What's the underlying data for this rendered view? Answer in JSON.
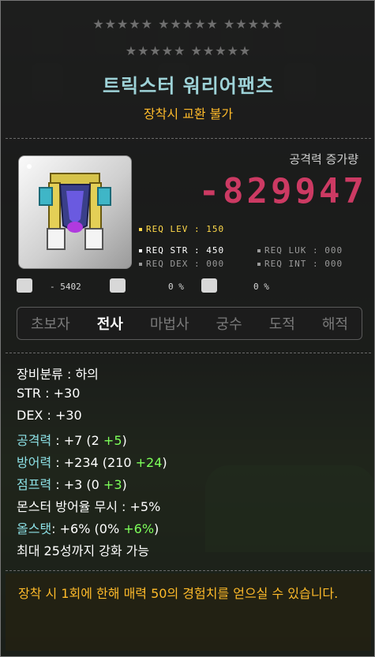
{
  "stars": {
    "row1": "★★★★★ ★★★★★ ★★★★★",
    "row2": "★★★★★ ★★★★★"
  },
  "item": {
    "name": "트릭스터 워리어팬츠",
    "note": "장착시 교환 불가",
    "icon": "warrior-pants-icon"
  },
  "attack": {
    "label": "공격력 증가량",
    "value": "-829947"
  },
  "requirements": {
    "lev": "REQ LEV : 150",
    "str": "REQ STR : 450",
    "luk": "REQ LUK : 000",
    "dex": "REQ DEX : 000",
    "int": "REQ INT : 000"
  },
  "badges": {
    "mini1_value": "- 5402",
    "pct1": "0 %",
    "pct2": "0 %"
  },
  "jobs": [
    "초보자",
    "전사",
    "마법사",
    "궁수",
    "도적",
    "해적"
  ],
  "stats": {
    "category": "장비분류 : 하의",
    "str": "STR : +30",
    "dex": "DEX : +30",
    "atk": {
      "k": "공격력",
      "v1": " : +7 (2 ",
      "v2": "+5",
      "v3": ")"
    },
    "def": {
      "k": "방어력",
      "v1": " : +234 (210 ",
      "v2": "+24",
      "v3": ")"
    },
    "jump": {
      "k": "점프력",
      "v1": " : +3 (0 ",
      "v2": "+3",
      "v3": ")"
    },
    "ignore": "몬스터 방어율 무시 : +5%",
    "all": {
      "k": "올스탯",
      "v1": ": +6% (0% ",
      "v2": "+6%",
      "v3": ")"
    },
    "enhance": "최대 25성까지 강화 가능"
  },
  "description": "장착 시 1회에 한해 매력 50의 경험치를 얻으실 수 있습니다.",
  "colors": {
    "name": "#9ed3d8",
    "note": "#ffbb2a",
    "attack": "#cc3a63",
    "bonus": "#7dff5a",
    "stat_key": "#8ce0e5"
  }
}
